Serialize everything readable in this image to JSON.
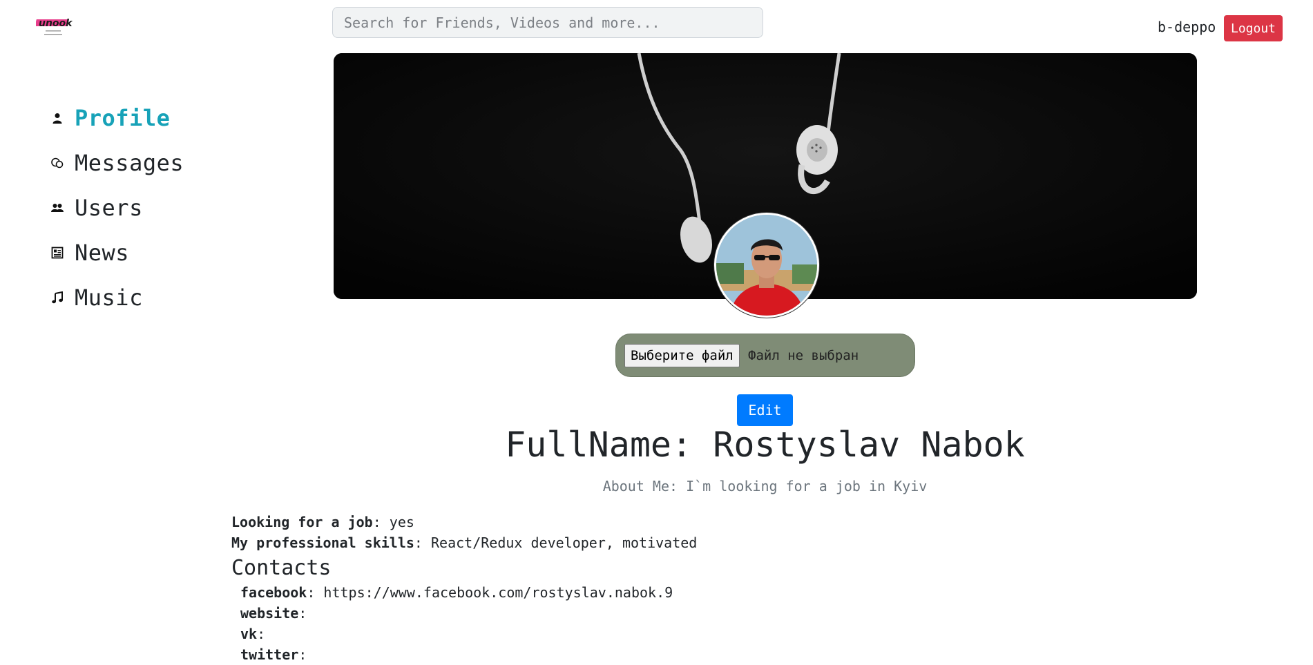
{
  "header": {
    "logo_text": "unook",
    "search": {
      "placeholder": "Search for Friends, Videos and more...",
      "value": ""
    },
    "username": "b-deppo",
    "logout_label": "Logout"
  },
  "sidebar": {
    "items": [
      {
        "label": "Profile",
        "icon": "person-icon",
        "active": true
      },
      {
        "label": "Messages",
        "icon": "chat-icon",
        "active": false
      },
      {
        "label": "Users",
        "icon": "users-icon",
        "active": false
      },
      {
        "label": "News",
        "icon": "newspaper-icon",
        "active": false
      },
      {
        "label": "Music",
        "icon": "music-note-icon",
        "active": false
      }
    ]
  },
  "profile": {
    "file_input": {
      "button_label": "Выберите файл",
      "status": "Файл не выбран"
    },
    "edit_label": "Edit",
    "fullname": "FullName: Rostyslav Nabok",
    "about": "About Me: I`m looking for a job in Kyiv",
    "looking_for_job": {
      "label": "Looking for a job",
      "value": "yes"
    },
    "skills": {
      "label": "My professional skills",
      "value": "React/Redux developer, motivated"
    },
    "contacts_title": "Contacts",
    "contacts": [
      {
        "label": "facebook",
        "value": "https://www.facebook.com/rostyslav.nabok.9"
      },
      {
        "label": "website",
        "value": ""
      },
      {
        "label": "vk",
        "value": ""
      },
      {
        "label": "twitter",
        "value": ""
      }
    ]
  },
  "colors": {
    "active_nav": "#17a2b8",
    "logout": "#dc3545",
    "edit": "#007bff",
    "file_box": "#7f8c76"
  }
}
